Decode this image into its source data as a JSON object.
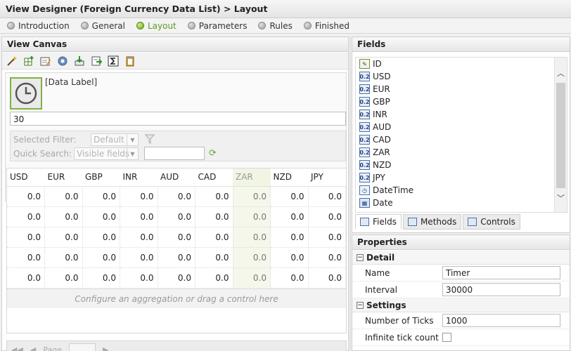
{
  "title": "View Designer (Foreign Currency Data List) > Layout",
  "wizard_steps": [
    {
      "label": "Introduction",
      "active": false
    },
    {
      "label": "General",
      "active": false
    },
    {
      "label": "Layout",
      "active": true
    },
    {
      "label": "Parameters",
      "active": false
    },
    {
      "label": "Rules",
      "active": false
    },
    {
      "label": "Finished",
      "active": false
    }
  ],
  "canvas": {
    "header": "View Canvas",
    "data_label": "[Data Label]",
    "timer_value": "30",
    "selected_filter_label": "Selected Filter:",
    "selected_filter_value": "Default",
    "quick_search_label": "Quick Search:",
    "quick_search_value": "Visible fields",
    "agg_hint": "Configure an aggregation or drag a control here",
    "pager_label": "Page"
  },
  "grid": {
    "columns": [
      "USD",
      "EUR",
      "GBP",
      "INR",
      "AUD",
      "CAD",
      "ZAR",
      "NZD",
      "JPY"
    ],
    "highlight_column": "ZAR",
    "rows": [
      [
        "0.0",
        "0.0",
        "0.0",
        "0.0",
        "0.0",
        "0.0",
        "0.0",
        "0.0",
        "0.0"
      ],
      [
        "0.0",
        "0.0",
        "0.0",
        "0.0",
        "0.0",
        "0.0",
        "0.0",
        "0.0",
        "0.0"
      ],
      [
        "0.0",
        "0.0",
        "0.0",
        "0.0",
        "0.0",
        "0.0",
        "0.0",
        "0.0",
        "0.0"
      ],
      [
        "0.0",
        "0.0",
        "0.0",
        "0.0",
        "0.0",
        "0.0",
        "0.0",
        "0.0",
        "0.0"
      ],
      [
        "0.0",
        "0.0",
        "0.0",
        "0.0",
        "0.0",
        "0.0",
        "0.0",
        "0.0",
        "0.0"
      ]
    ]
  },
  "fields": {
    "header": "Fields",
    "items": [
      {
        "label": "ID",
        "icon": "id-field-icon",
        "icon_text": ""
      },
      {
        "label": "USD",
        "icon": "decimal-field-icon",
        "icon_text": "0.2"
      },
      {
        "label": "EUR",
        "icon": "decimal-field-icon",
        "icon_text": "0.2"
      },
      {
        "label": "GBP",
        "icon": "decimal-field-icon",
        "icon_text": "0.2"
      },
      {
        "label": "INR",
        "icon": "decimal-field-icon",
        "icon_text": "0.2"
      },
      {
        "label": "AUD",
        "icon": "decimal-field-icon",
        "icon_text": "0.2"
      },
      {
        "label": "CAD",
        "icon": "decimal-field-icon",
        "icon_text": "0.2"
      },
      {
        "label": "ZAR",
        "icon": "decimal-field-icon",
        "icon_text": "0.2"
      },
      {
        "label": "NZD",
        "icon": "decimal-field-icon",
        "icon_text": "0.2"
      },
      {
        "label": "JPY",
        "icon": "decimal-field-icon",
        "icon_text": "0.2"
      },
      {
        "label": "DateTime",
        "icon": "datetime-field-icon",
        "icon_text": ""
      },
      {
        "label": "Date",
        "icon": "date-field-icon",
        "icon_text": ""
      }
    ],
    "tabs": [
      {
        "label": "Fields",
        "active": true,
        "icon": "fields-tab-icon"
      },
      {
        "label": "Methods",
        "active": false,
        "icon": "methods-tab-icon"
      },
      {
        "label": "Controls",
        "active": false,
        "icon": "controls-tab-icon"
      }
    ]
  },
  "properties": {
    "header": "Properties",
    "sections": [
      {
        "title": "Detail",
        "rows": [
          {
            "name": "Name",
            "value": "Timer",
            "type": "text"
          },
          {
            "name": "Interval",
            "value": "30000",
            "type": "text"
          }
        ]
      },
      {
        "title": "Settings",
        "rows": [
          {
            "name": "Number of Ticks",
            "value": "1000",
            "type": "text"
          },
          {
            "name": "Infinite tick count",
            "value": "",
            "type": "checkbox"
          }
        ]
      }
    ]
  },
  "colors": {
    "active_step": "#5e9a24",
    "timer_border": "#7fb240",
    "highlight_column_bg": "#f1f5e4"
  }
}
